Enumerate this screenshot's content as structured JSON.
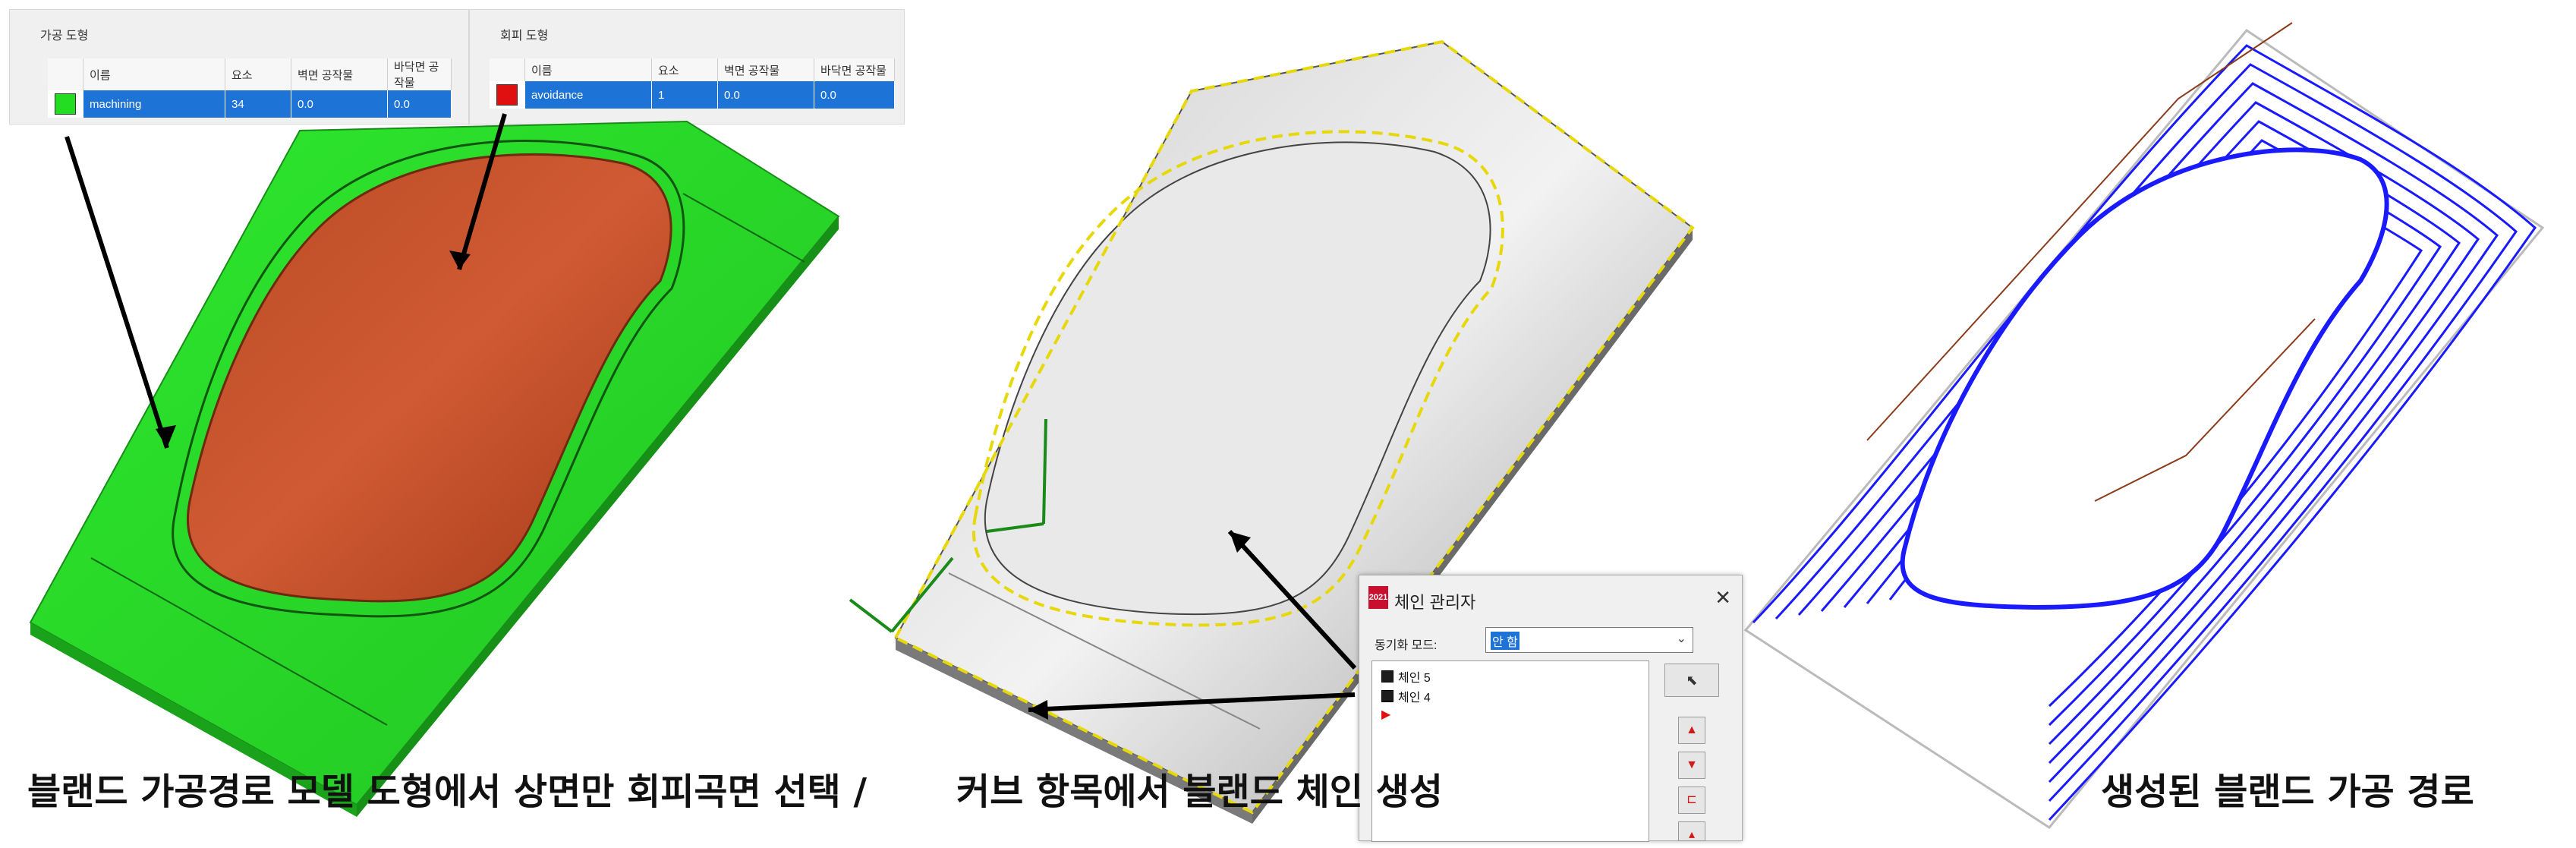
{
  "machining_group": {
    "title": "가공 도형",
    "columns": [
      "",
      "이름",
      "요소",
      "벽면 공작물",
      "바닥면 공작물"
    ],
    "row": {
      "color": "#22dd22",
      "name": "machining",
      "elements": "34",
      "wall_stock": "0.0",
      "floor_stock": "0.0"
    }
  },
  "avoidance_group": {
    "title": "회피 도형",
    "columns": [
      "",
      "이름",
      "요소",
      "벽면 공작물",
      "바닥면 공작물"
    ],
    "row": {
      "color": "#e01010",
      "name": "avoidance",
      "elements": "1",
      "wall_stock": "0.0",
      "floor_stock": "0.0"
    }
  },
  "chain_manager": {
    "title": "체인 관리자",
    "logo_text": "2021",
    "close": "✕",
    "sync_mode_label": "동기화 모드:",
    "sync_mode_value": "안 함",
    "chains": [
      "체인 5",
      "체인 4"
    ],
    "select_icon": "cursor-icon"
  },
  "captions": {
    "left": "블랜드 가공경로 모델 도형에서 상면만 회피곡면 선택 /",
    "middle": "커브 항목에서 블랜드 체인 생성",
    "right": "생성된 블랜드 가공 경로"
  },
  "colors": {
    "machining": "#22dd22",
    "avoidance": "#e01010",
    "toolpath": "#1a1aff",
    "selection": "#1e73d6"
  }
}
